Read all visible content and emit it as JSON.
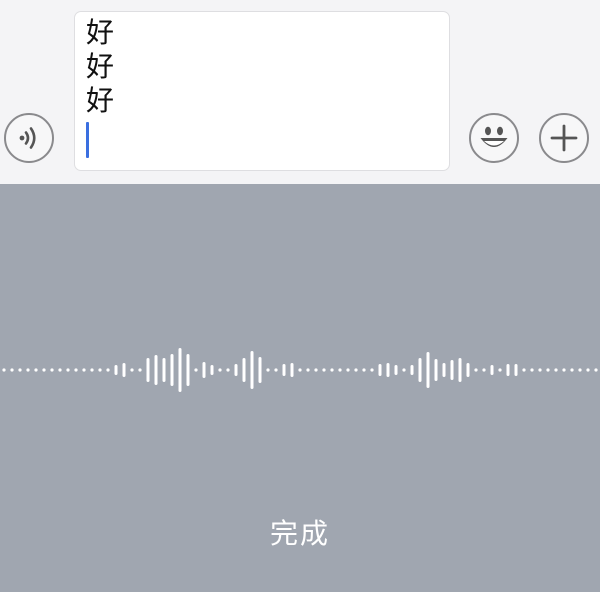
{
  "composer": {
    "lines": [
      "好",
      "好",
      "好"
    ],
    "voice_icon": "voice-wave-icon",
    "emoji_icon": "smiley-icon",
    "plus_icon": "plus-icon"
  },
  "voice_input": {
    "done_label": "完成",
    "waveform_color": "#ffffff"
  },
  "colors": {
    "toolbar_bg": "#f4f4f6",
    "panel_bg": "#a0a6b0",
    "caret": "#3a6fe0"
  }
}
